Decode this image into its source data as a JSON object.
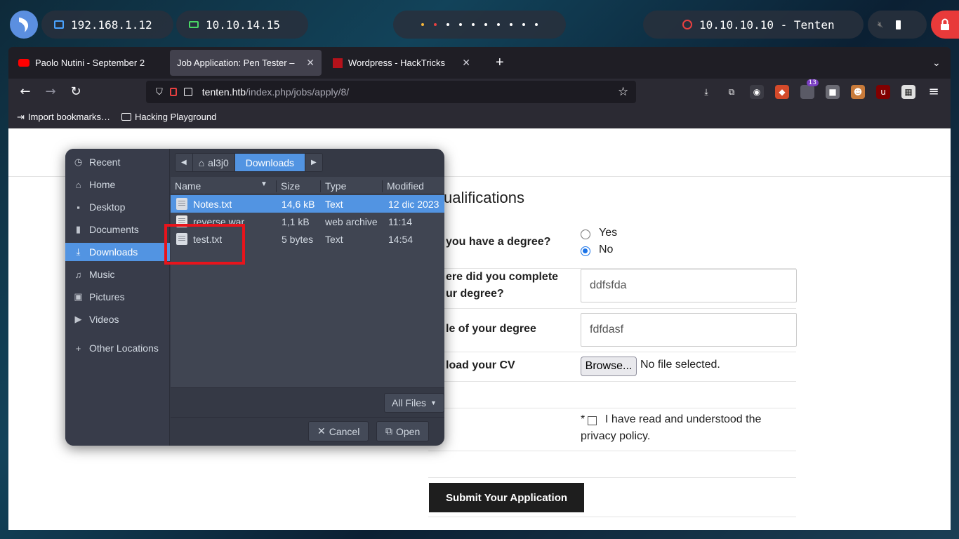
{
  "desktop": {
    "ip_lan": "192.168.1.12",
    "ip_vpn": "10.10.14.15",
    "target": "10.10.10.10 - Tenten"
  },
  "browser": {
    "tabs": [
      {
        "title": "Paolo Nutini - September 2",
        "favicon": "youtube-icon"
      },
      {
        "title": "Job Application: Pen Tester – Je",
        "favicon": "wordpress-icon"
      },
      {
        "title": "Wordpress - HackTricks",
        "favicon": "hacktricks-icon"
      }
    ],
    "url_host": "tenten.htb",
    "url_path": "/index.php/jobs/apply/8/",
    "ext_badge": "13",
    "bookmarks": [
      "Import bookmarks…",
      "Hacking Playground"
    ]
  },
  "form": {
    "section_heading": "ualifications",
    "q_degree": "you have a degree?",
    "opt_yes": "Yes",
    "opt_no": "No",
    "q_where_line1": "ere did you complete",
    "q_where_line2": "ur degree?",
    "where_value": "ddfsfda",
    "q_title": "le of your degree",
    "title_value": "fdfdasf",
    "q_cv": "load your CV",
    "browse_label": "Browse...",
    "no_file": "No file selected.",
    "required_mark": "*",
    "privacy_line1": "I have read and understood the",
    "privacy_line2": "privacy policy.",
    "submit_label": "Submit Your Application"
  },
  "dialog": {
    "sidebar": [
      {
        "label": "Recent",
        "icon": "clock-icon"
      },
      {
        "label": "Home",
        "icon": "home-icon"
      },
      {
        "label": "Desktop",
        "icon": "desktop-icon"
      },
      {
        "label": "Documents",
        "icon": "document-icon"
      },
      {
        "label": "Downloads",
        "icon": "download-icon"
      },
      {
        "label": "Music",
        "icon": "music-icon"
      },
      {
        "label": "Pictures",
        "icon": "picture-icon"
      },
      {
        "label": "Videos",
        "icon": "video-icon"
      },
      {
        "label": "Other Locations",
        "icon": "plus-icon"
      }
    ],
    "path": [
      "al3j0",
      "Downloads"
    ],
    "columns": {
      "name": "Name",
      "size": "Size",
      "type": "Type",
      "modified": "Modified"
    },
    "files": [
      {
        "name": "Notes.txt",
        "size": "14,6 kB",
        "type": "Text",
        "modified": "12 dic 2023"
      },
      {
        "name": "reverse.war",
        "size": "1,1 kB",
        "type": "web archive",
        "modified": "11:14"
      },
      {
        "name": "test.txt",
        "size": "5 bytes",
        "type": "Text",
        "modified": "14:54"
      }
    ],
    "filter": "All Files",
    "cancel": "Cancel",
    "open": "Open"
  }
}
